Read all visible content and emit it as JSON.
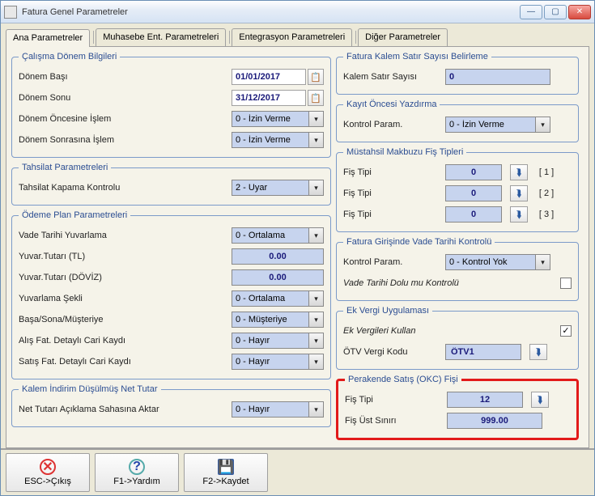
{
  "window": {
    "title": "Fatura Genel Parametreler"
  },
  "tabs": {
    "t1": "Ana Parametreler",
    "t2": "Muhasebe Ent. Parametreleri",
    "t3": "Entegrasyon Parametreleri",
    "t4": "Diğer Parametreler"
  },
  "calisma_donem": {
    "legend": "Çalışma Dönem Bilgileri",
    "basi_label": "Dönem Başı",
    "basi_value": "01/01/2017",
    "sonu_label": "Dönem Sonu",
    "sonu_value": "31/12/2017",
    "oncesine_label": "Dönem Öncesine İşlem",
    "oncesine_value": "0 - İzin Verme",
    "sonrasina_label": "Dönem Sonrasına İşlem",
    "sonrasina_value": "0 - İzin Verme"
  },
  "tahsilat": {
    "legend": "Tahsilat Parametreleri",
    "kapama_label": "Tahsilat Kapama Kontrolu",
    "kapama_value": "2 - Uyar"
  },
  "odeme_plan": {
    "legend": "Ödeme Plan Parametreleri",
    "vade_yuvarlama_label": "Vade Tarihi Yuvarlama",
    "vade_yuvarlama_value": "0 - Ortalama",
    "yuvar_tl_label": "Yuvar.Tutarı (TL)",
    "yuvar_tl_value": "0.00",
    "yuvar_dov_label": "Yuvar.Tutarı (DÖVİZ)",
    "yuvar_dov_value": "0.00",
    "yuvarlama_sekli_label": "Yuvarlama Şekli",
    "yuvarlama_sekli_value": "0 - Ortalama",
    "basa_sona_label": "Başa/Sona/Müşteriye",
    "basa_sona_value": "0 - Müşteriye",
    "alis_detay_label": "Alış Fat. Detaylı Cari Kaydı",
    "alis_detay_value": "0 - Hayır",
    "satis_detay_label": "Satış Fat. Detaylı Cari Kaydı",
    "satis_detay_value": "0 - Hayır"
  },
  "kalem_indirim": {
    "legend": "Kalem İndirim Düşülmüş Net Tutar",
    "net_aktar_label": "Net Tutarı Açıklama Sahasına Aktar",
    "net_aktar_value": "0 - Hayır"
  },
  "fatura_kalem": {
    "legend": "Fatura Kalem Satır Sayısı Belirleme",
    "satir_label": "Kalem Satır Sayısı",
    "satir_value": "0"
  },
  "kayit_oncesi": {
    "legend": "Kayıt Öncesi Yazdırma",
    "kontrol_label": "Kontrol Param.",
    "kontrol_value": "0 - İzin Verme"
  },
  "mustahsil": {
    "legend": "Müstahsil Makbuzu Fiş Tipleri",
    "fis_label": "Fiş Tipi",
    "v1": "0",
    "s1": "[ 1 ]",
    "v2": "0",
    "s2": "[ 2 ]",
    "v3": "0",
    "s3": "[ 3 ]"
  },
  "fatura_vade": {
    "legend": "Fatura Girişinde Vade Tarihi Kontrolü",
    "kontrol_label": "Kontrol Param.",
    "kontrol_value": "0 - Kontrol Yok",
    "dolu_label": "Vade Tarihi Dolu mu Kontrolü"
  },
  "ek_vergi": {
    "legend": "Ek Vergi Uygulaması",
    "kullan_label": "Ek Vergileri Kullan",
    "otv_label": "ÖTV Vergi Kodu",
    "otv_value": "ÖTV1"
  },
  "perakende": {
    "legend": "Perakende Satış (OKC) Fişi",
    "fis_tipi_label": "Fiş Tipi",
    "fis_tipi_value": "12",
    "ust_sinir_label": "Fiş Üst Sınırı",
    "ust_sinir_value": "999.00"
  },
  "footer": {
    "esc": "ESC->Çıkış",
    "f1": "F1->Yardım",
    "f2": "F2->Kaydet"
  }
}
